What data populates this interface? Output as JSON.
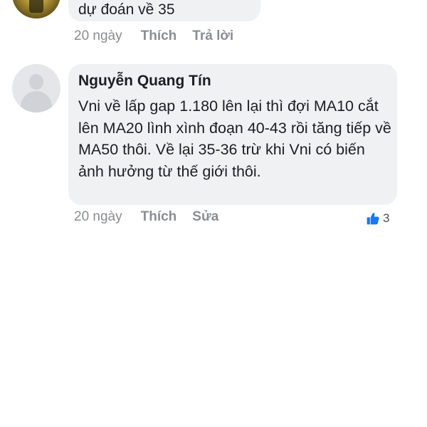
{
  "comments": [
    {
      "text": "dự đoán về 35",
      "time": "20 ngày",
      "like_label": "Thích",
      "reply_label": "Trả lời"
    },
    {
      "author": "Nguyễn Quang Tín",
      "text": "Vni về lấp gap 1.180 lên lại thì đợi MA10 cắt lên MA20 lình xình đoạn 40-43 rồi tăng tiếp về MA50 thôi. Về lại 35-36 trừ khi Vni có biến ảnh hưởng từ thế giới thôi.",
      "time": "20 ngày",
      "like_label": "Thích",
      "edit_label": "Sửa",
      "reaction_count": "3",
      "reaction_icon": "thumbs-up-icon",
      "reaction_color": "#1877f2"
    }
  ]
}
